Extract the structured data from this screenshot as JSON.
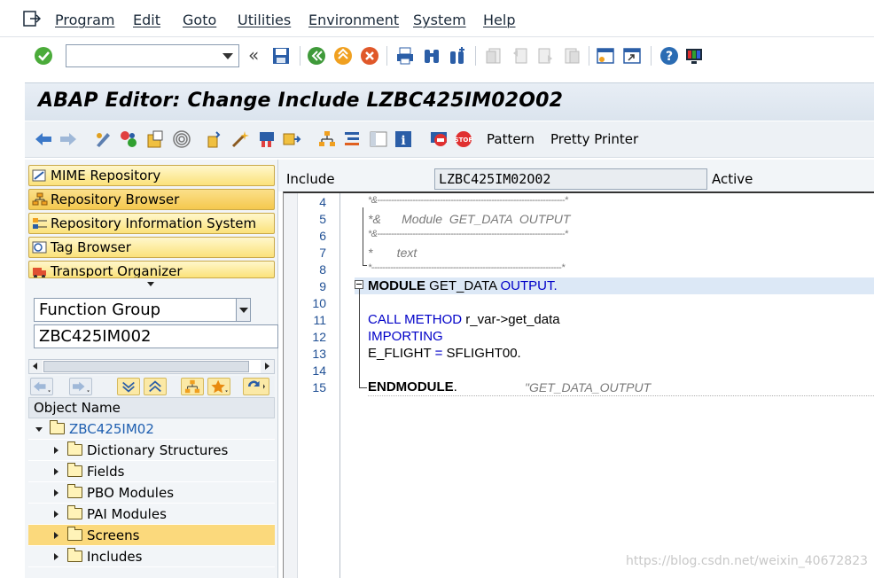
{
  "menu": {
    "items": [
      "Program",
      "Edit",
      "Goto",
      "Utilities",
      "Environment",
      "System",
      "Help"
    ]
  },
  "system_toolbar": {
    "command_field": "",
    "icons": [
      "enter-icon",
      "back-icon",
      "save-icon",
      "back-green-icon",
      "exit-icon",
      "cancel-icon",
      "print-icon",
      "find-icon",
      "find-next-icon",
      "first-page-icon",
      "previous-page-icon",
      "next-page-icon",
      "last-page-icon",
      "new-session-icon",
      "shortcut-icon",
      "help-icon",
      "customize-layout-icon"
    ]
  },
  "title": "ABAP Editor: Change Include LZBC425IM02O02",
  "app_toolbar": {
    "pattern_label": "Pattern",
    "pretty_printer_label": "Pretty Printer"
  },
  "navigation": {
    "buttons": [
      "MIME Repository",
      "Repository Browser",
      "Repository Information System",
      "Tag Browser",
      "Transport Organizer"
    ],
    "object_type": "Function Group",
    "object_name": "ZBC425IM002"
  },
  "tree": {
    "header": "Object Name",
    "root": "ZBC425IM02",
    "nodes": [
      "Dictionary Structures",
      "Fields",
      "PBO Modules",
      "PAI Modules",
      "Screens",
      "Includes"
    ],
    "selected": "Screens"
  },
  "editor": {
    "include_label": "Include",
    "include_value": "LZBC425IM02O02",
    "status": "Active",
    "lines": [
      {
        "n": "4",
        "text": "*&---------------------------------------------------------------------*"
      },
      {
        "n": "5",
        "text": "*&      Module  GET_DATA  OUTPUT"
      },
      {
        "n": "6",
        "text": "*&---------------------------------------------------------------------*"
      },
      {
        "n": "7",
        "text": "*       text"
      },
      {
        "n": "8",
        "text": "*----------------------------------------------------------------------*"
      },
      {
        "n": "9",
        "kw1": "MODULE",
        "mid": " GET_DATA ",
        "kw2": "OUTPUT",
        "end": "."
      },
      {
        "n": "10",
        "text": ""
      },
      {
        "n": "11",
        "kw1": "CALL METHOD",
        "mid": " r_var->get_data"
      },
      {
        "n": "12",
        "kw1": "IMPORTING"
      },
      {
        "n": "13",
        "mid1": "E_FLIGHT ",
        "op": "=",
        "mid2": " SFLIGHT00."
      },
      {
        "n": "14",
        "text": ""
      },
      {
        "n": "15",
        "kw1": "ENDMODULE",
        "end": ".",
        "comment": "\"GET_DATA_OUTPUT"
      }
    ]
  },
  "watermark": "https://blog.csdn.net/weixin_40672823"
}
